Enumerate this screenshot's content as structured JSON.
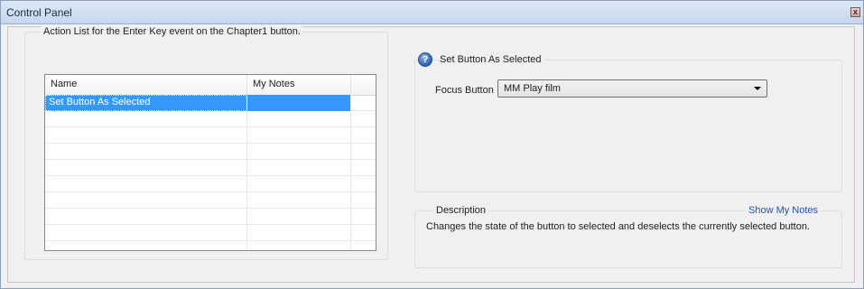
{
  "window": {
    "title": "Control Panel",
    "close_label": "x"
  },
  "action_list": {
    "legend": "Action List for the Enter Key event on the Chapter1 button.",
    "columns": [
      "Name",
      "My Notes",
      ""
    ],
    "rows": [
      {
        "name": "Set Button As Selected",
        "notes": ""
      },
      {
        "name": "",
        "notes": ""
      },
      {
        "name": "",
        "notes": ""
      },
      {
        "name": "",
        "notes": ""
      },
      {
        "name": "",
        "notes": ""
      },
      {
        "name": "",
        "notes": ""
      },
      {
        "name": "",
        "notes": ""
      },
      {
        "name": "",
        "notes": ""
      },
      {
        "name": "",
        "notes": ""
      },
      {
        "name": "",
        "notes": ""
      }
    ],
    "selected_index": 0
  },
  "action_detail": {
    "help_icon": "help-icon",
    "title": "Set Button As Selected",
    "focus_label": "Focus Button",
    "focus_value": "MM Play film"
  },
  "description": {
    "title": "Description",
    "show_notes_link": "Show My Notes",
    "text": "Changes the state of the button to selected and deselects the currently selected button."
  },
  "colors": {
    "selection": "#3399ff",
    "link": "#1f50c8",
    "title_bar": "#c5d6ec"
  }
}
